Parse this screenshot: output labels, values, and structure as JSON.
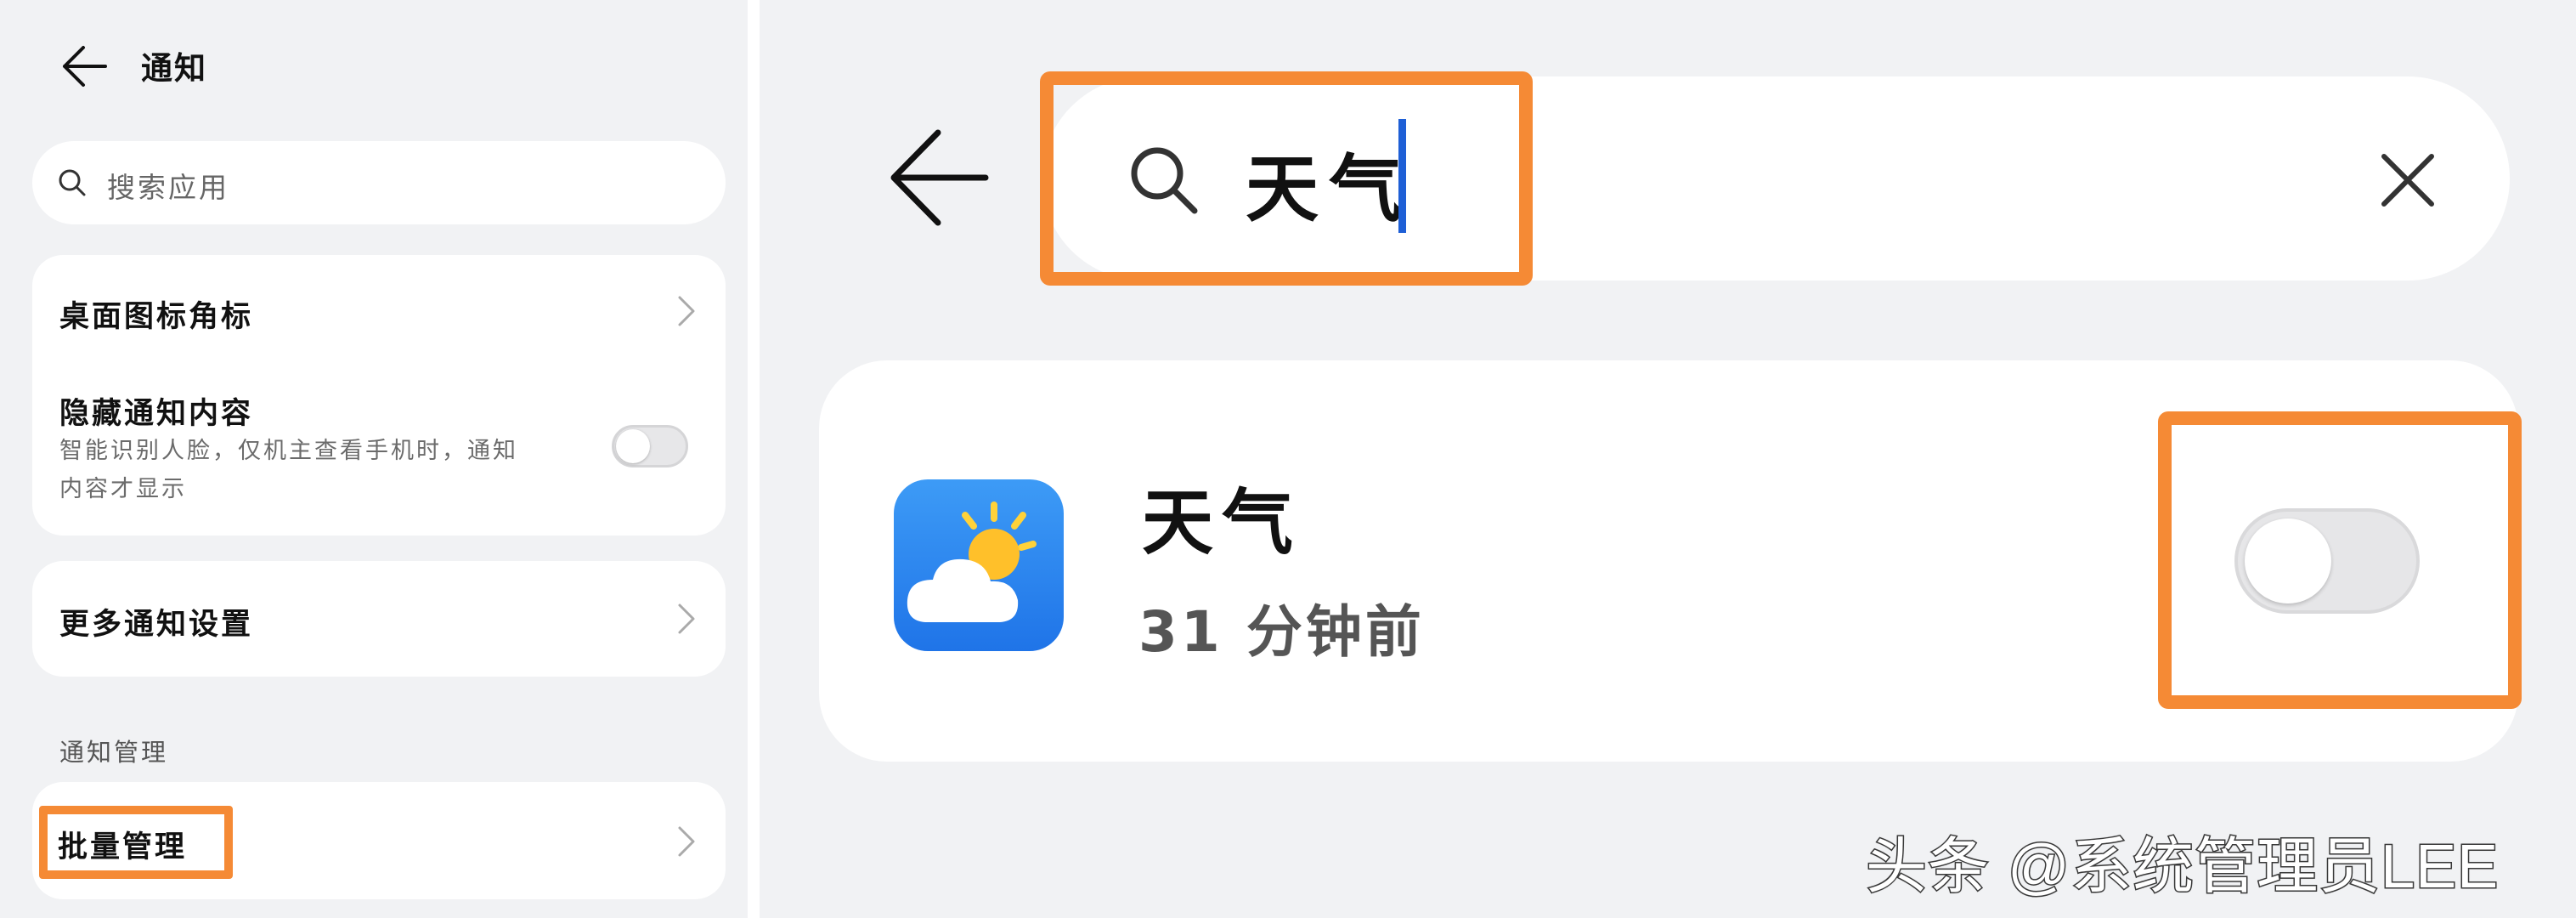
{
  "left_panel": {
    "title": "通知",
    "search_placeholder": "搜索应用",
    "items": [
      {
        "title": "桌面图标角标"
      },
      {
        "title": "隐藏通知内容",
        "subtitle_line1": "智能识别人脸，仅机主查看手机时，通知",
        "subtitle_line2": "内容才显示",
        "toggle_on": false
      },
      {
        "title": "更多通知设置"
      }
    ],
    "section_label": "通知管理",
    "batch_item": {
      "title": "批量管理"
    }
  },
  "right_panel": {
    "search_query": "天气",
    "result": {
      "app_name": "天气",
      "time": "31 分钟前",
      "toggle_on": false
    }
  },
  "watermark": "头条 @系统管理员LEE",
  "colors": {
    "highlight": "#f58a35",
    "caret": "#1e5fd6",
    "background": "#f1f2f4",
    "card": "#ffffff"
  },
  "icons": [
    "back-arrow-icon",
    "search-icon",
    "chevron-right-icon",
    "clear-icon",
    "weather-app-icon"
  ]
}
